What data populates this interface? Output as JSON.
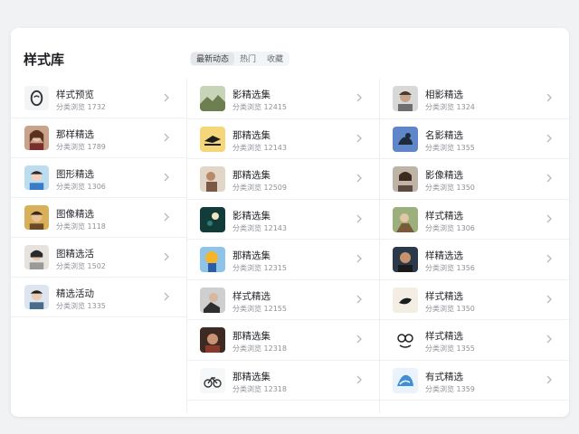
{
  "header": {
    "title": "样式库",
    "tabs": [
      {
        "label": "最新动态",
        "active": true
      },
      {
        "label": "热门",
        "active": false
      },
      {
        "label": "收藏",
        "active": false
      }
    ]
  },
  "columns": [
    {
      "items": [
        {
          "name": "样式预览",
          "meta": "分类浏览 1732",
          "avatar": "logo-icon"
        },
        {
          "name": "那样精选",
          "meta": "分类浏览 1789",
          "avatar": "portrait-icon"
        },
        {
          "name": "图形精选",
          "meta": "分类浏览 1306",
          "avatar": "portrait-icon"
        },
        {
          "name": "图像精选",
          "meta": "分类浏览 1118",
          "avatar": "portrait-icon"
        },
        {
          "name": "图精选活",
          "meta": "分类浏览 1502",
          "avatar": "portrait-icon"
        },
        {
          "name": "精选活动",
          "meta": "分类浏览 1335",
          "avatar": "portrait-icon"
        }
      ]
    },
    {
      "items": [
        {
          "name": "影精选集",
          "meta": "分类浏览 12415",
          "avatar": "landscape-icon"
        },
        {
          "name": "那精选集",
          "meta": "分类浏览 12143",
          "avatar": "bird-icon"
        },
        {
          "name": "那精选集",
          "meta": "分类浏览 12509",
          "avatar": "photo-icon"
        },
        {
          "name": "影精选集",
          "meta": "分类浏览 12143",
          "avatar": "night-icon"
        },
        {
          "name": "那精选集",
          "meta": "分类浏览 12315",
          "avatar": "cartoon-icon"
        },
        {
          "name": "样式精选",
          "meta": "分类浏览 12155",
          "avatar": "portrait-icon"
        },
        {
          "name": "那精选集",
          "meta": "分类浏览 12318",
          "avatar": "portrait-icon"
        },
        {
          "name": "那精选集",
          "meta": "分类浏览 12318",
          "avatar": "bicycle-icon"
        }
      ]
    },
    {
      "items": [
        {
          "name": "相影精选",
          "meta": "分类浏览 1324",
          "avatar": "portrait-icon"
        },
        {
          "name": "名影精选",
          "meta": "分类浏览 1355",
          "avatar": "bird-icon"
        },
        {
          "name": "影像精选",
          "meta": "分类浏览 1350",
          "avatar": "portrait-icon"
        },
        {
          "name": "样式精选",
          "meta": "分类浏览 1306",
          "avatar": "photo-icon"
        },
        {
          "name": "样精选选",
          "meta": "分类浏览 1356",
          "avatar": "portrait-icon"
        },
        {
          "name": "样式精选",
          "meta": "分类浏览 1350",
          "avatar": "drawing-icon"
        },
        {
          "name": "样式精选",
          "meta": "分类浏览 1355",
          "avatar": "doodle-icon"
        },
        {
          "name": "有式精选",
          "meta": "分类浏览 1359",
          "avatar": "wave-icon"
        }
      ]
    }
  ]
}
